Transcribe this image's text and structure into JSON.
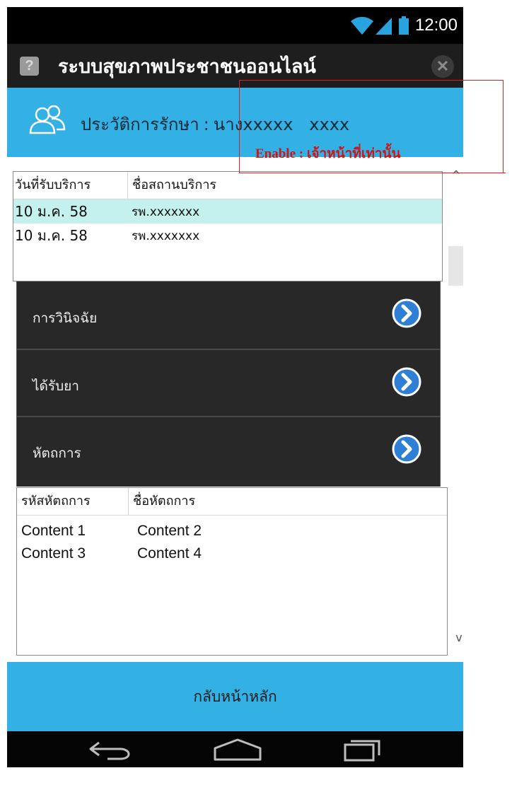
{
  "status_bar": {
    "time": "12:00",
    "icons": [
      "wifi-icon",
      "signal-icon",
      "battery-icon"
    ]
  },
  "title_bar": {
    "help_icon": "?",
    "title": "ระบบสุขภาพประชาชนออนไลน์",
    "close_icon": "✕"
  },
  "patient_header": {
    "icon": "users-icon",
    "label": "ประวัติการรักษา",
    "separator": ":",
    "patient_name": "นางxxxxx   xxxx"
  },
  "annotation": {
    "text": "Enable : เจ้าหน้าที่เท่านั้น",
    "color": "#d01515"
  },
  "visits_table": {
    "columns": [
      "วันที่รับบริการ",
      "ชื่อสถานบริการ"
    ],
    "rows": [
      {
        "date": "10 ม.ค. 58",
        "facility": "รพ.xxxxxxx",
        "selected": true
      },
      {
        "date": "10 ม.ค. 58",
        "facility": "รพ.xxxxxxx",
        "selected": false
      }
    ]
  },
  "menu": {
    "items": [
      {
        "label": "การวินิจฉัย",
        "icon": "chevron-right-circle-icon"
      },
      {
        "label": "ได้รับยา",
        "icon": "chevron-right-circle-icon"
      },
      {
        "label": "หัตถการ",
        "icon": "chevron-right-circle-icon"
      }
    ]
  },
  "procedures_table": {
    "columns": [
      "รหัสหัตถการ",
      "ชื่อหัตถการ"
    ],
    "rows": [
      [
        "Content 1",
        "Content 2"
      ],
      [
        "Content 3",
        "Content 4"
      ]
    ]
  },
  "scrollbar": {
    "up_arrow": "^",
    "down_arrow": "v"
  },
  "back_button": {
    "label": "กลับหน้าหลัก"
  },
  "nav_bar": {
    "icons": [
      "back-icon",
      "home-icon",
      "recent-apps-icon"
    ]
  },
  "colors": {
    "accent": "#33b1e4",
    "title_bar": "#1e1e1e",
    "menu_bg": "#282828",
    "selected_row": "#c4f1ee",
    "arrow_icon": "#2f7fd6"
  }
}
